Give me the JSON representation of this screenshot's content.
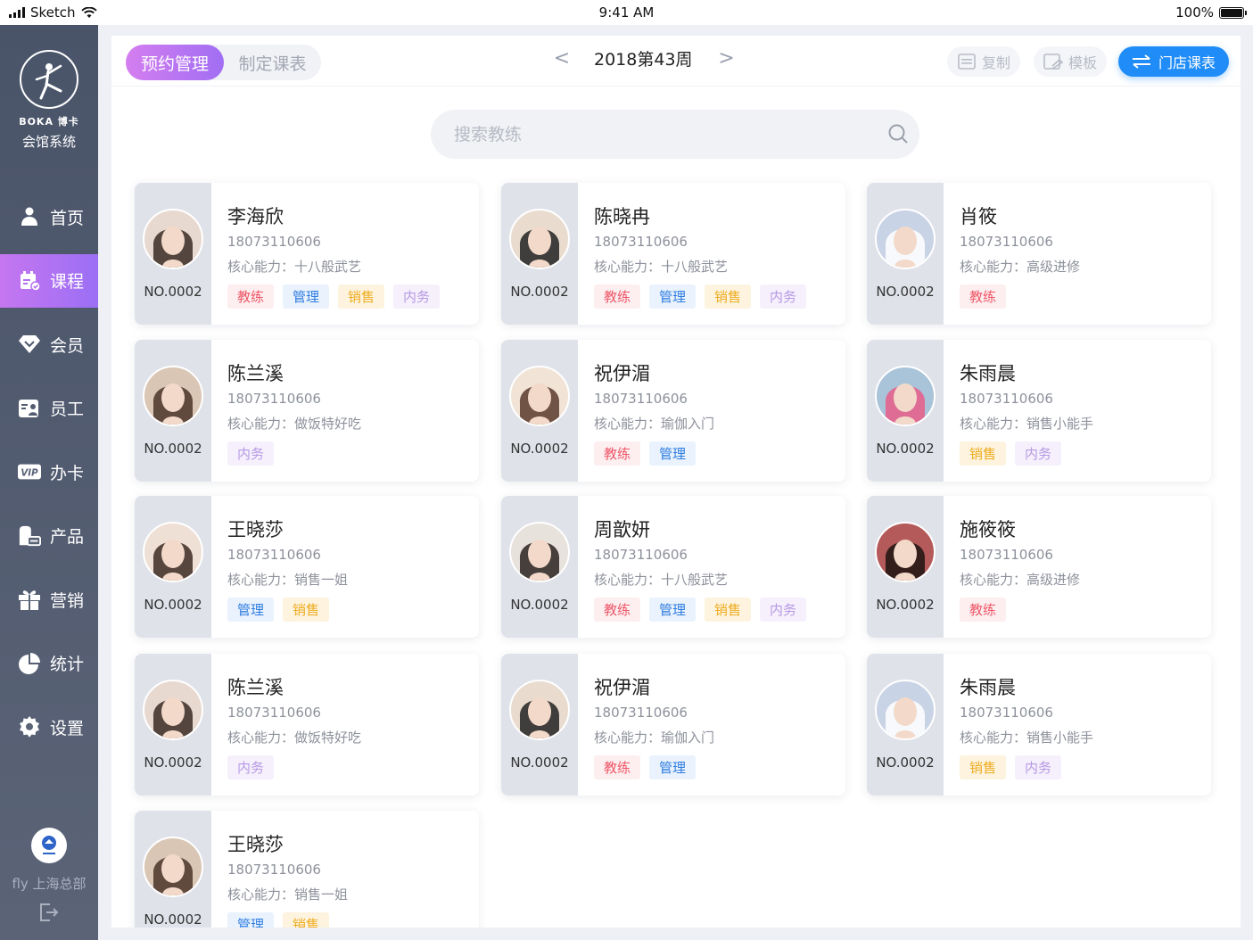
{
  "status_bar": {
    "carrier": "Sketch",
    "time": "9:41 AM",
    "battery": "100%"
  },
  "sidebar": {
    "brand": "BOKA 博卡",
    "system_name": "会馆系统",
    "nav": [
      {
        "label": "首页",
        "icon": "home-person-icon",
        "active": false
      },
      {
        "label": "课程",
        "icon": "course-calendar-icon",
        "active": true
      },
      {
        "label": "会员",
        "icon": "diamond-icon",
        "active": false
      },
      {
        "label": "员工",
        "icon": "staff-icon",
        "active": false
      },
      {
        "label": "办卡",
        "icon": "vip-card-icon",
        "active": false
      },
      {
        "label": "产品",
        "icon": "product-icon",
        "active": false
      },
      {
        "label": "营销",
        "icon": "gift-icon",
        "active": false
      },
      {
        "label": "统计",
        "icon": "pie-chart-icon",
        "active": false
      },
      {
        "label": "设置",
        "icon": "gear-icon",
        "active": false
      }
    ],
    "user": "fly 上海总部"
  },
  "toolbar": {
    "tab_active": "预约管理",
    "tab_inactive": "制定课表",
    "prev": "<",
    "week": "2018第43周",
    "next": ">",
    "copy": "复制",
    "template": "模板",
    "store_schedule": "门店课表"
  },
  "search": {
    "placeholder": "搜索教练"
  },
  "skill_prefix": "核心能力：",
  "tag_labels": {
    "coach": "教练",
    "admin": "管理",
    "sales": "销售",
    "office": "内务"
  },
  "coaches": [
    {
      "name": "李海欣",
      "phone": "18073110606",
      "skill": "十八般武艺",
      "no": "NO.0002",
      "tags": [
        "coach",
        "admin",
        "sales",
        "office"
      ]
    },
    {
      "name": "陈晓冉",
      "phone": "18073110606",
      "skill": "十八般武艺",
      "no": "NO.0002",
      "tags": [
        "coach",
        "admin",
        "sales",
        "office"
      ]
    },
    {
      "name": "肖筱",
      "phone": "18073110606",
      "skill": "高级进修",
      "no": "NO.0002",
      "tags": [
        "coach"
      ]
    },
    {
      "name": "陈兰溪",
      "phone": "18073110606",
      "skill": "做饭特好吃",
      "no": "NO.0002",
      "tags": [
        "office"
      ]
    },
    {
      "name": "祝伊湄",
      "phone": "18073110606",
      "skill": "瑜伽入门",
      "no": "NO.0002",
      "tags": [
        "coach",
        "admin"
      ]
    },
    {
      "name": "朱雨晨",
      "phone": "18073110606",
      "skill": "销售小能手",
      "no": "NO.0002",
      "tags": [
        "sales",
        "office"
      ]
    },
    {
      "name": "王晓莎",
      "phone": "18073110606",
      "skill": "销售一姐",
      "no": "NO.0002",
      "tags": [
        "admin",
        "sales"
      ]
    },
    {
      "name": "周歆妍",
      "phone": "18073110606",
      "skill": "十八般武艺",
      "no": "NO.0002",
      "tags": [
        "coach",
        "admin",
        "sales",
        "office"
      ]
    },
    {
      "name": "施筱筱",
      "phone": "18073110606",
      "skill": "高级进修",
      "no": "NO.0002",
      "tags": [
        "coach"
      ]
    },
    {
      "name": "陈兰溪",
      "phone": "18073110606",
      "skill": "做饭特好吃",
      "no": "NO.0002",
      "tags": [
        "office"
      ]
    },
    {
      "name": "祝伊湄",
      "phone": "18073110606",
      "skill": "瑜伽入门",
      "no": "NO.0002",
      "tags": [
        "coach",
        "admin"
      ]
    },
    {
      "name": "朱雨晨",
      "phone": "18073110606",
      "skill": "销售小能手",
      "no": "NO.0002",
      "tags": [
        "sales",
        "office"
      ]
    },
    {
      "name": "王晓莎",
      "phone": "18073110606",
      "skill": "销售一姐",
      "no": "NO.0002",
      "tags": [
        "admin",
        "sales"
      ]
    }
  ],
  "colors": {
    "accent_gradient_start": "#d47ef0",
    "accent_gradient_end": "#a16ef3",
    "primary_blue": "#1f8cf7",
    "sidebar": "#4a5469"
  }
}
